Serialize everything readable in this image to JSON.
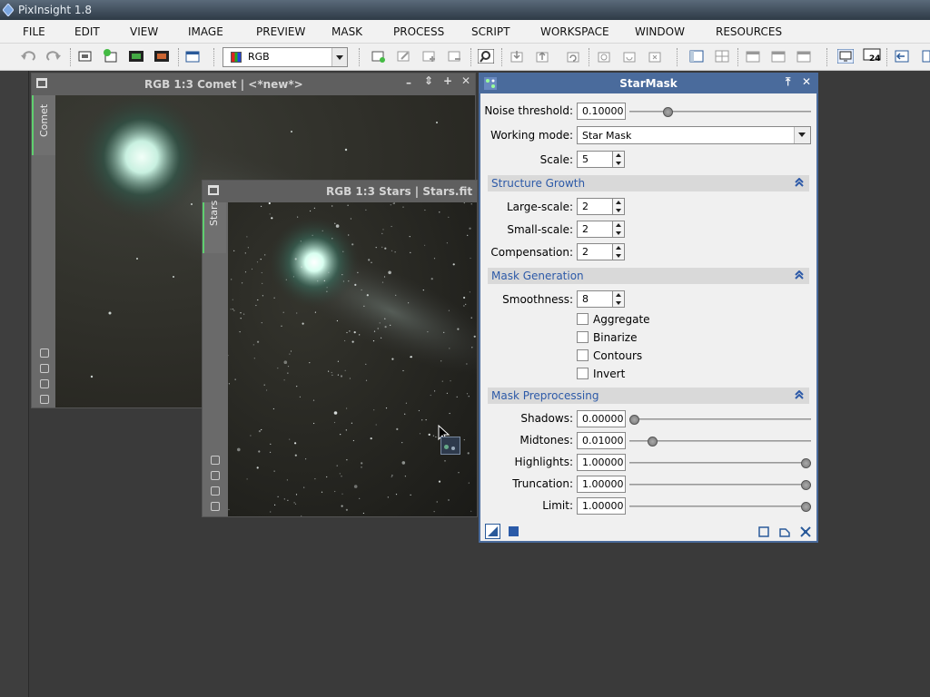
{
  "app": {
    "title": "PixInsight 1.8"
  },
  "menu": [
    "FILE",
    "EDIT",
    "VIEW",
    "IMAGE",
    "PREVIEW",
    "MASK",
    "PROCESS",
    "SCRIPT",
    "WORKSPACE",
    "WINDOW",
    "RESOURCES"
  ],
  "toolbar": {
    "channel_value": "RGB",
    "zoom_badge": "24"
  },
  "windows": {
    "comet": {
      "title": "RGB 1:3 Comet | <*new*>",
      "tab": "Comet"
    },
    "stars": {
      "title": "RGB 1:3 Stars | Stars.fit",
      "tab": "Stars"
    }
  },
  "starmask": {
    "title": "StarMask",
    "noise_threshold": {
      "label": "Noise threshold:",
      "value": "0.10000",
      "level": 0.1
    },
    "working_mode": {
      "label": "Working mode:",
      "value": "Star Mask"
    },
    "scale": {
      "label": "Scale:",
      "value": "5"
    },
    "structure_growth": {
      "header": "Structure Growth",
      "large_scale": {
        "label": "Large-scale:",
        "value": "2"
      },
      "small_scale": {
        "label": "Small-scale:",
        "value": "2"
      },
      "compensation": {
        "label": "Compensation:",
        "value": "2"
      }
    },
    "mask_generation": {
      "header": "Mask Generation",
      "smoothness": {
        "label": "Smoothness:",
        "value": "8"
      },
      "aggregate": {
        "label": "Aggregate",
        "checked": false
      },
      "binarize": {
        "label": "Binarize",
        "checked": false
      },
      "contours": {
        "label": "Contours",
        "checked": false
      },
      "invert": {
        "label": "Invert",
        "checked": false
      }
    },
    "mask_preprocessing": {
      "header": "Mask Preprocessing",
      "shadows": {
        "label": "Shadows:",
        "value": "0.00000",
        "level": 0.0
      },
      "midtones": {
        "label": "Midtones:",
        "value": "0.01000",
        "level": 0.01
      },
      "highlights": {
        "label": "Highlights:",
        "value": "1.00000",
        "level": 1.0
      },
      "truncation": {
        "label": "Truncation:",
        "value": "1.00000",
        "level": 1.0
      },
      "limit": {
        "label": "Limit:",
        "value": "1.00000",
        "level": 1.0
      }
    }
  },
  "colors": {
    "panel_accent": "#4a6b9c",
    "section_text": "#2d5aa8",
    "view_tab_accent": "#5fcf6f"
  }
}
